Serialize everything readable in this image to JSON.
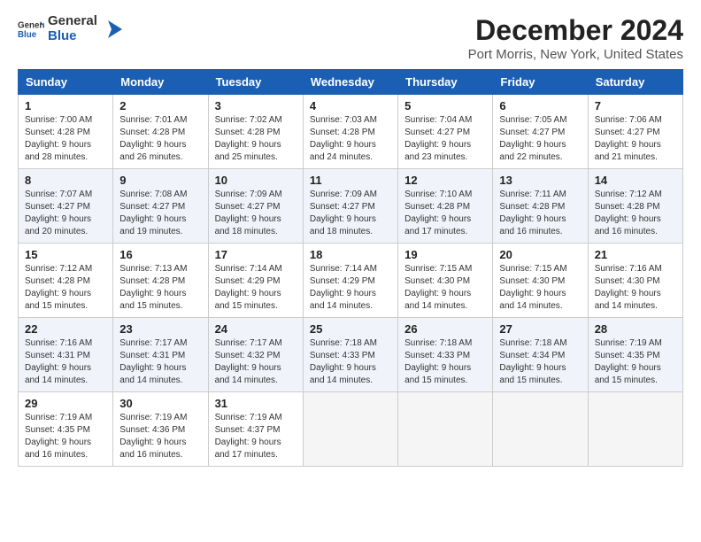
{
  "header": {
    "logo_general": "General",
    "logo_blue": "Blue",
    "title": "December 2024",
    "subtitle": "Port Morris, New York, United States"
  },
  "columns": [
    "Sunday",
    "Monday",
    "Tuesday",
    "Wednesday",
    "Thursday",
    "Friday",
    "Saturday"
  ],
  "weeks": [
    [
      {
        "day": "1",
        "sunrise": "7:00 AM",
        "sunset": "4:28 PM",
        "daylight": "9 hours and 28 minutes."
      },
      {
        "day": "2",
        "sunrise": "7:01 AM",
        "sunset": "4:28 PM",
        "daylight": "9 hours and 26 minutes."
      },
      {
        "day": "3",
        "sunrise": "7:02 AM",
        "sunset": "4:28 PM",
        "daylight": "9 hours and 25 minutes."
      },
      {
        "day": "4",
        "sunrise": "7:03 AM",
        "sunset": "4:28 PM",
        "daylight": "9 hours and 24 minutes."
      },
      {
        "day": "5",
        "sunrise": "7:04 AM",
        "sunset": "4:27 PM",
        "daylight": "9 hours and 23 minutes."
      },
      {
        "day": "6",
        "sunrise": "7:05 AM",
        "sunset": "4:27 PM",
        "daylight": "9 hours and 22 minutes."
      },
      {
        "day": "7",
        "sunrise": "7:06 AM",
        "sunset": "4:27 PM",
        "daylight": "9 hours and 21 minutes."
      }
    ],
    [
      {
        "day": "8",
        "sunrise": "7:07 AM",
        "sunset": "4:27 PM",
        "daylight": "9 hours and 20 minutes."
      },
      {
        "day": "9",
        "sunrise": "7:08 AM",
        "sunset": "4:27 PM",
        "daylight": "9 hours and 19 minutes."
      },
      {
        "day": "10",
        "sunrise": "7:09 AM",
        "sunset": "4:27 PM",
        "daylight": "9 hours and 18 minutes."
      },
      {
        "day": "11",
        "sunrise": "7:09 AM",
        "sunset": "4:27 PM",
        "daylight": "9 hours and 18 minutes."
      },
      {
        "day": "12",
        "sunrise": "7:10 AM",
        "sunset": "4:28 PM",
        "daylight": "9 hours and 17 minutes."
      },
      {
        "day": "13",
        "sunrise": "7:11 AM",
        "sunset": "4:28 PM",
        "daylight": "9 hours and 16 minutes."
      },
      {
        "day": "14",
        "sunrise": "7:12 AM",
        "sunset": "4:28 PM",
        "daylight": "9 hours and 16 minutes."
      }
    ],
    [
      {
        "day": "15",
        "sunrise": "7:12 AM",
        "sunset": "4:28 PM",
        "daylight": "9 hours and 15 minutes."
      },
      {
        "day": "16",
        "sunrise": "7:13 AM",
        "sunset": "4:28 PM",
        "daylight": "9 hours and 15 minutes."
      },
      {
        "day": "17",
        "sunrise": "7:14 AM",
        "sunset": "4:29 PM",
        "daylight": "9 hours and 15 minutes."
      },
      {
        "day": "18",
        "sunrise": "7:14 AM",
        "sunset": "4:29 PM",
        "daylight": "9 hours and 14 minutes."
      },
      {
        "day": "19",
        "sunrise": "7:15 AM",
        "sunset": "4:30 PM",
        "daylight": "9 hours and 14 minutes."
      },
      {
        "day": "20",
        "sunrise": "7:15 AM",
        "sunset": "4:30 PM",
        "daylight": "9 hours and 14 minutes."
      },
      {
        "day": "21",
        "sunrise": "7:16 AM",
        "sunset": "4:30 PM",
        "daylight": "9 hours and 14 minutes."
      }
    ],
    [
      {
        "day": "22",
        "sunrise": "7:16 AM",
        "sunset": "4:31 PM",
        "daylight": "9 hours and 14 minutes."
      },
      {
        "day": "23",
        "sunrise": "7:17 AM",
        "sunset": "4:31 PM",
        "daylight": "9 hours and 14 minutes."
      },
      {
        "day": "24",
        "sunrise": "7:17 AM",
        "sunset": "4:32 PM",
        "daylight": "9 hours and 14 minutes."
      },
      {
        "day": "25",
        "sunrise": "7:18 AM",
        "sunset": "4:33 PM",
        "daylight": "9 hours and 14 minutes."
      },
      {
        "day": "26",
        "sunrise": "7:18 AM",
        "sunset": "4:33 PM",
        "daylight": "9 hours and 15 minutes."
      },
      {
        "day": "27",
        "sunrise": "7:18 AM",
        "sunset": "4:34 PM",
        "daylight": "9 hours and 15 minutes."
      },
      {
        "day": "28",
        "sunrise": "7:19 AM",
        "sunset": "4:35 PM",
        "daylight": "9 hours and 15 minutes."
      }
    ],
    [
      {
        "day": "29",
        "sunrise": "7:19 AM",
        "sunset": "4:35 PM",
        "daylight": "9 hours and 16 minutes."
      },
      {
        "day": "30",
        "sunrise": "7:19 AM",
        "sunset": "4:36 PM",
        "daylight": "9 hours and 16 minutes."
      },
      {
        "day": "31",
        "sunrise": "7:19 AM",
        "sunset": "4:37 PM",
        "daylight": "9 hours and 17 minutes."
      },
      null,
      null,
      null,
      null
    ]
  ],
  "labels": {
    "sunrise": "Sunrise:",
    "sunset": "Sunset:",
    "daylight": "Daylight:"
  }
}
